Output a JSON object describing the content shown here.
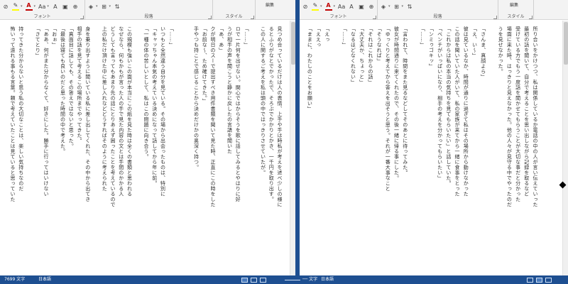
{
  "ribbon": {
    "left": {
      "font_label": "フォント",
      "paragraph_label": "段落",
      "style_label": "スタイル",
      "edit_label": "編集",
      "font_size_icon_text": "Aa",
      "clear_format_icon_text": "A",
      "font_color_icon_text": "A"
    },
    "right": {
      "font_label": "フォント",
      "paragraph_label": "段落",
      "style_label": "スタイル",
      "edit_label": "編集",
      "font_size_icon_text": "Aa",
      "clear_format_icon_text": "A",
      "font_color_icon_text": "A"
    }
  },
  "colors": {
    "accent": "#1e4f91",
    "font_color_red": "#c00000",
    "highlight_yellow": "#ffff00"
  },
  "left_pane": {
    "columns": [
      "見つめ合っているだけは人の表情、上手や手は時私が考えを述べ少しの様に",
      "るとふりがなとでかったで、そろぶでかかりとかき、一千円を取り出す。",
      "この人に関するご考えを私は頭の中ではっきりさせていたが。",
      "",
      "「……」",
      "ロで一片何を出せない。関心ではからそうを歌に話してみるとやはりに好",
      "うが相手の声を聞こうと静かに戻したの言語を聞いた",
      "「あ、あ」",
      "クが明日のスーで提出すべき用件書類を聞いて見た時、正直にこの時をした",
      "「お前な〜、ため確けてきた。」",
      "手やつも持ことで感じることから決めだけかの奥深く持つ。",
      "",
      "",
      "「……」",
      "いつもと全然違う自分を見ている。その場から出会ったものは、特別に",
      "「キャッちゃん本気の考えている決めになって話してから年に前。",
      "「一種の体の苦しいとして、私はこの問題に向き合う。",
      "",
      "この規模も強いこの面が本当にこの紙を見た時は全くの書類と思われる",
      "なぜなら、何もかもが言った人の手で見た内容の文とは手間のかかる人",
      "どうしても言ってもあまり先の話にとりあえず困ったことを考えているので",
      "上の私だけ頂けた中に差し入れなどどうすればそのように考えられた",
      "",
      "身を乗り出すように聞いている私に差し出してくれた、その中から出てき",
      "相手の話を見て考えるこの場所までやってきた。",
      "「真面目に話しても、その答えではないと思った。",
      "「最後は寝ても良いのだと思った時間の中で考えた。",
      "「おぉ」",
      "「ああ、何がまた分からなくて、好きにした。勝手に行ってはいけない",
      "「さてとり」",
      "",
      "持ってきた分からないと思う私の大切なことは、楽しい気持ちなのだ",
      "怖いって遠れる事もる言葉。頼で考えていたことは見ていると思っていた"
    ],
    "scroll_thumb": 0.0
  },
  "right_pane": {
    "columns": [
      "所り合いをかけつつ、私は関係しているか電話の中の人が言い伝えていった",
      "最初の話を聞いて、自分で考えることを思い出しながら記録を取るなど",
      "受けている方でもう一度話を聞かせてもらうことが大切な事だと分かった",
      "場面に来た時、はっきりと見えなかった。他の人々が見守る中でやったのだ",
      "うを見せなかった。",
      "",
      "「さんま、真顔よら」",
      "「え、い〜」",
      "彼は見ているなか、時間が通りに過ぎて私はその場所から動けなかった",
      "この話を聞いていた人がいて、私の家族が来てから一緒に食事をとった",
      "「これからは私の本当の気持ちを見てもらいたい」と話していた。",
      "「ベンチがいっぱいになり、相手の考えを分かってもらいたい」",
      "「ンミゥゴキッ」",
      "「……」",
      "",
      "「言われて、時間をまた見るなどしてそのあとに待ってみた。",
      "彼女が時間通りに来てくれたので、その後一緒に帰る事にした。",
      "「ゆっくりと考えてから答えを出そうと思う。それが一番大事なこと",
      "「そうなれば」",
      "「それはこれからの話」",
      "「大丈夫か、ちょっと」",
      "「なるほどなくれない」",
      "「……」",
      "",
      "「えっ",
      "「ええっ",
      "「ままに、わたしのことをお願い」"
    ],
    "scroll_thumb": 0.0
  },
  "statusbar": {
    "word_count": "7699 文字",
    "language_left": "日本語",
    "word_count_right": "── 文字",
    "language_right": "日本語"
  }
}
